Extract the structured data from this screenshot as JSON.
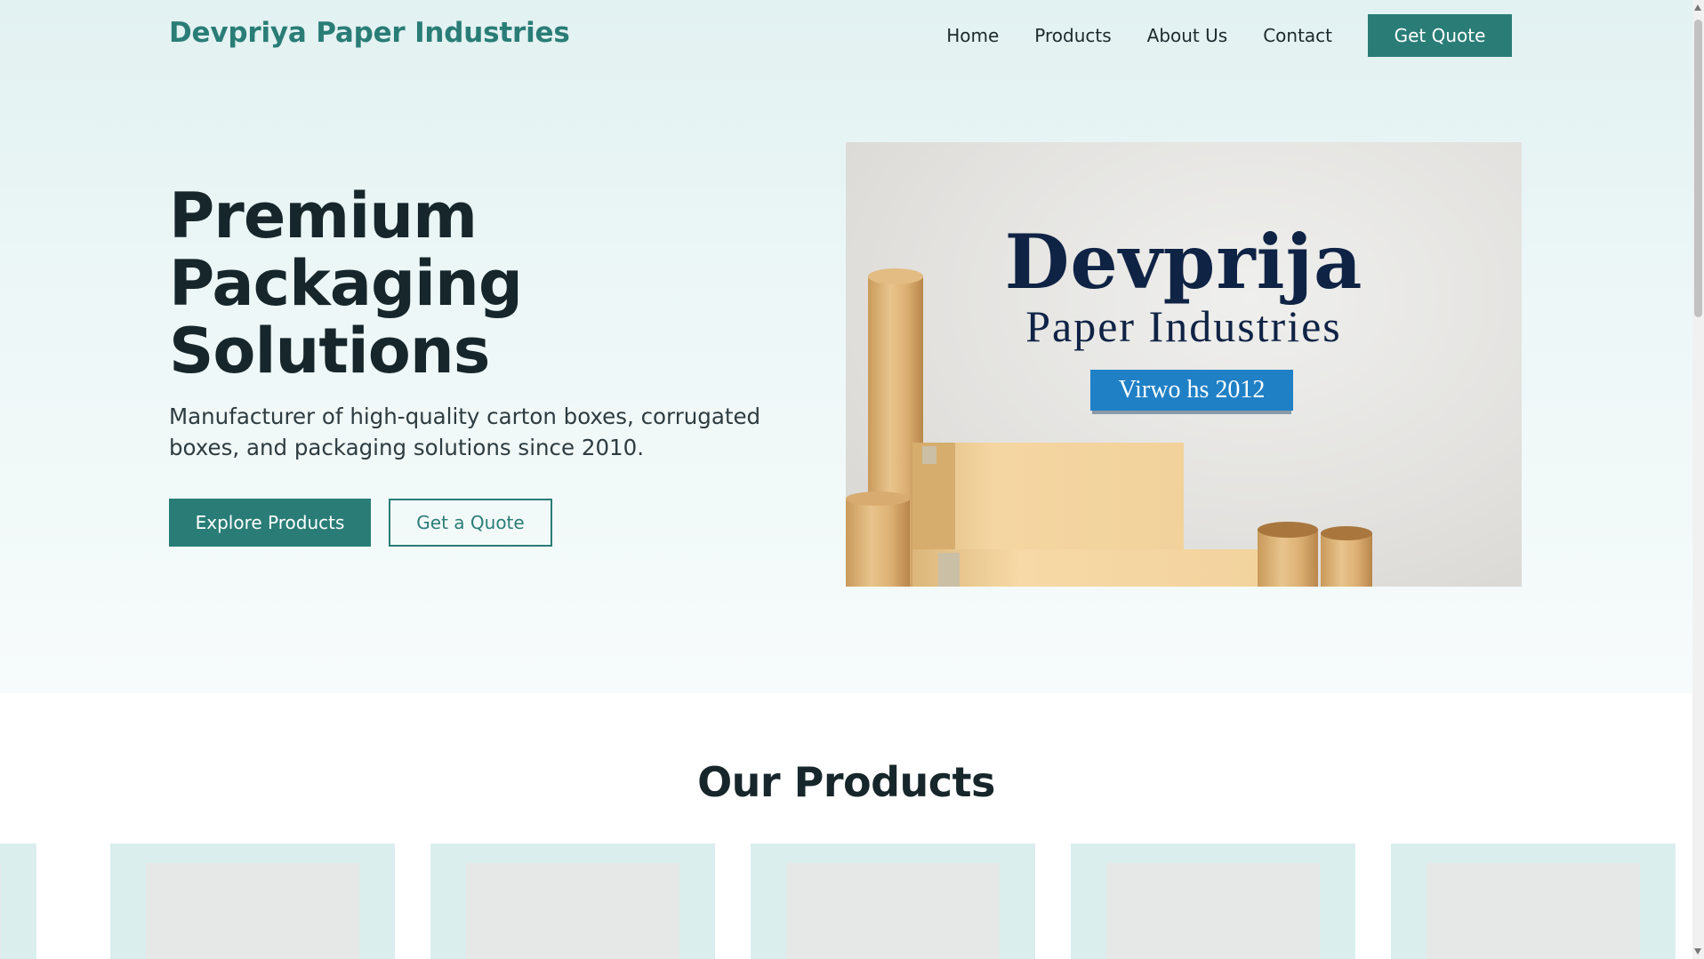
{
  "header": {
    "brand": "Devpriya Paper Industries",
    "nav": [
      "Home",
      "Products",
      "About Us",
      "Contact"
    ],
    "cta": "Get Quote"
  },
  "hero": {
    "title_lines": [
      "Premium",
      "Packaging",
      "Solutions"
    ],
    "subtitle": "Manufacturer of high-quality carton boxes, corrugated boxes, and packaging solutions since 2010.",
    "primary_button": "Explore Products",
    "secondary_button": "Get a Quote",
    "image": {
      "title": "Devprija",
      "subtitle": "Paper Industries",
      "badge": "Virwo hs 2012"
    }
  },
  "products": {
    "title": "Our Products",
    "cards": [
      "",
      "",
      "",
      "",
      "",
      ""
    ]
  },
  "colors": {
    "brand": "#2a7d77",
    "dark_text": "#17262a",
    "hero_bg": "#e2f1f1",
    "card_bg": "#dbeeee",
    "image_badge": "#1f80c6",
    "image_text": "#0f2345"
  },
  "icons": [
    "image-placeholder-icon",
    "scroll-up-icon",
    "scroll-down-icon"
  ]
}
